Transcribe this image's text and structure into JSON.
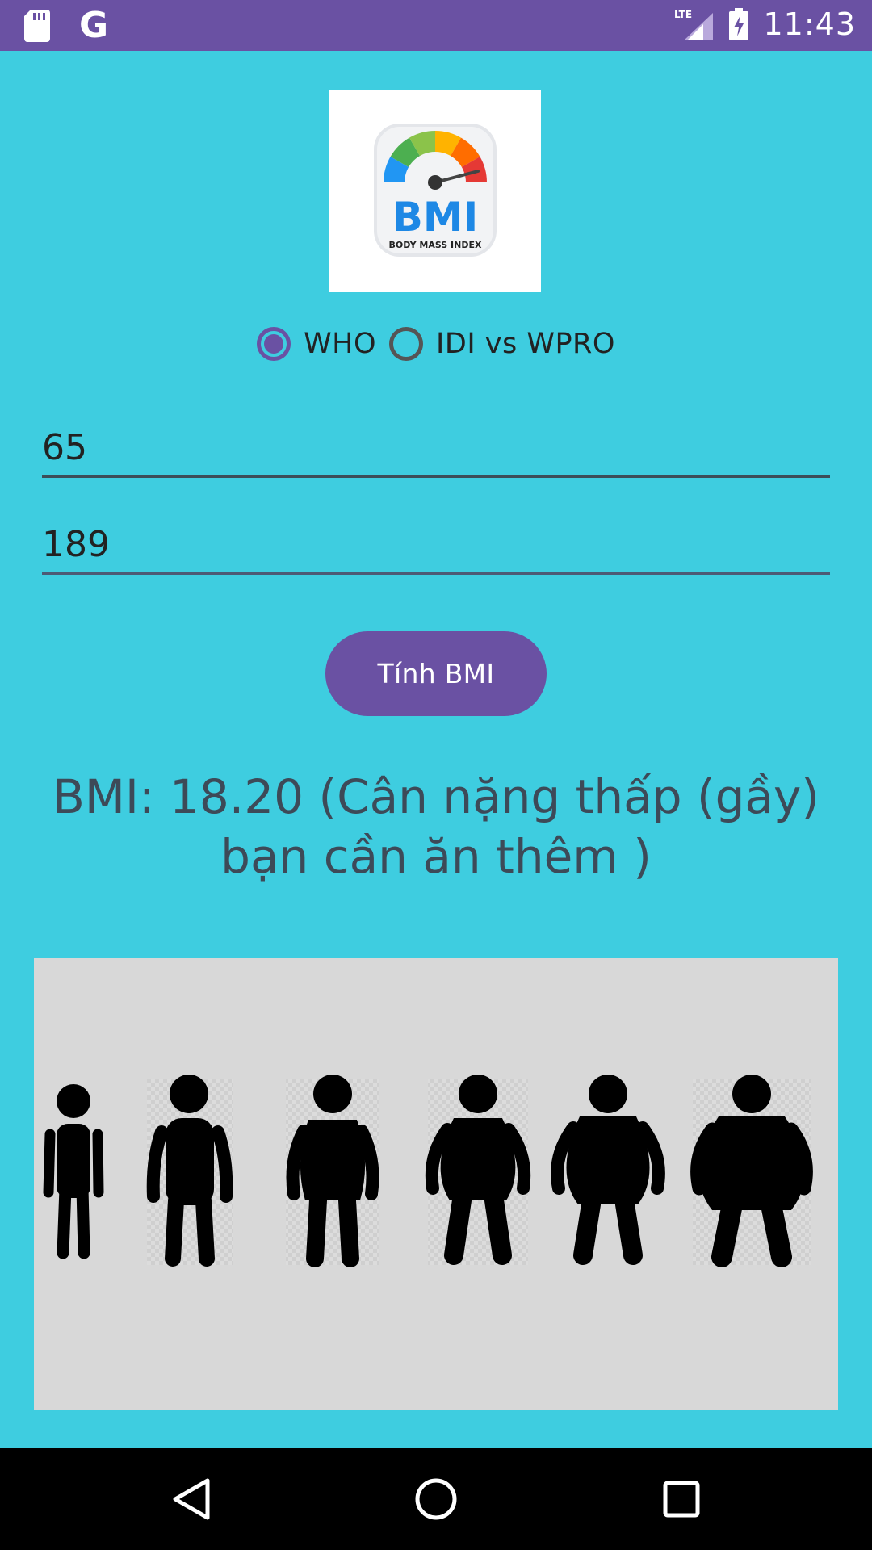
{
  "status_bar": {
    "network": "LTE",
    "time": "11:43",
    "left_icons": [
      "sd-card-icon",
      "google-icon"
    ],
    "right_icons": [
      "lte-signal-icon",
      "battery-charging-icon"
    ]
  },
  "logo": {
    "title": "BMI",
    "subtitle": "BODY MASS INDEX"
  },
  "standard_selector": {
    "options": [
      {
        "label": "WHO",
        "checked": true
      },
      {
        "label": "IDI vs WPRO",
        "checked": false
      }
    ]
  },
  "inputs": {
    "weight_value": "65",
    "height_value": "189"
  },
  "calculate_button": {
    "label": "Tính BMI"
  },
  "result": {
    "line1": "BMI: 18.20 (Cân nặng thấp (gầy)",
    "line2": "bạn cần ăn thêm )"
  },
  "body_types": {
    "figures": [
      "underweight",
      "normal",
      "overweight",
      "obese-1",
      "obese-2",
      "obese-3"
    ]
  },
  "colors": {
    "primary": "#6a51a3",
    "background": "#3ecde0",
    "panel": "#d8d8d8",
    "result_text": "#3d4a58"
  },
  "nav_bar": {
    "buttons": [
      "back-icon",
      "home-icon",
      "recents-icon"
    ]
  }
}
